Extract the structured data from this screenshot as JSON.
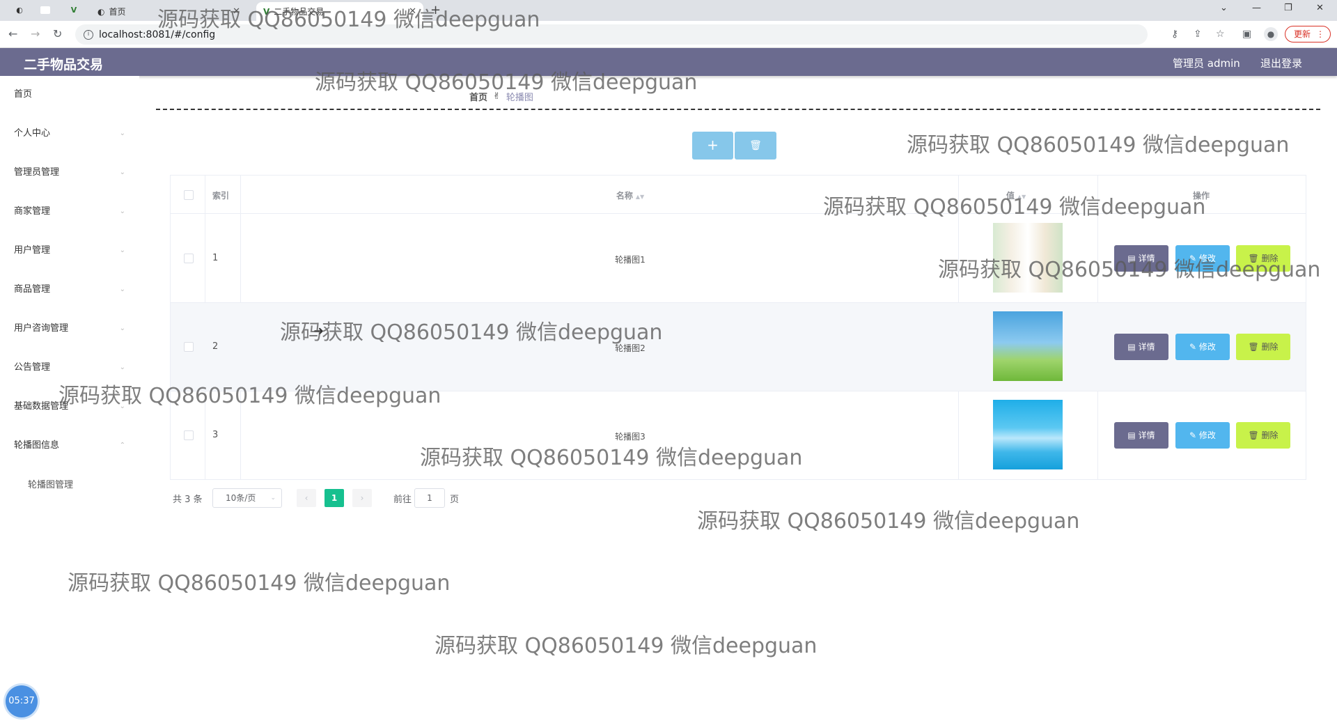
{
  "browser": {
    "tabs": [
      {
        "label": "首页"
      },
      {
        "label": "二手物品交易"
      }
    ],
    "url": "localhost:8081/#/config",
    "update_label": "更新"
  },
  "header": {
    "title": "二手物品交易",
    "user": "管理员 admin",
    "logout": "退出登录"
  },
  "sidebar": {
    "items": [
      {
        "label": "首页",
        "has_children": false
      },
      {
        "label": "个人中心",
        "has_children": true
      },
      {
        "label": "管理员管理",
        "has_children": true
      },
      {
        "label": "商家管理",
        "has_children": true
      },
      {
        "label": "用户管理",
        "has_children": true
      },
      {
        "label": "商品管理",
        "has_children": true
      },
      {
        "label": "用户咨询管理",
        "has_children": true
      },
      {
        "label": "公告管理",
        "has_children": true
      },
      {
        "label": "基础数据管理",
        "has_children": true
      },
      {
        "label": "轮播图信息",
        "has_children": true,
        "expanded": true
      }
    ],
    "sub_items": [
      {
        "label": "轮播图管理"
      }
    ]
  },
  "breadcrumb": {
    "home": "首页",
    "current": "轮播图"
  },
  "toolbar": {
    "add_label": "+",
    "delete_icon": "trash-icon"
  },
  "table": {
    "headers": {
      "index": "索引",
      "name": "名称",
      "value": "值",
      "actions": "操作"
    },
    "rows": [
      {
        "index": "1",
        "name": "轮播图1",
        "image": "light floral"
      },
      {
        "index": "2",
        "name": "轮播图2",
        "image": "green grass and sky"
      },
      {
        "index": "3",
        "name": "轮播图3",
        "image": "blue water splash"
      }
    ],
    "actions": {
      "detail": "详情",
      "edit": "修改",
      "delete": "删除"
    }
  },
  "pagination": {
    "total": "共 3 条",
    "page_size": "10条/页",
    "current_page": "1",
    "goto_label": "前往",
    "goto_value": "1",
    "page_unit": "页"
  },
  "watermark": "源码获取 QQ86050149 微信deepguan",
  "timer": "05:37",
  "colors": {
    "header_bg": "#6b6b8f",
    "detail_btn": "#6b6b8f",
    "edit_btn": "#52b6ee",
    "delete_btn": "#c8f24a",
    "page_active": "#16c08f"
  }
}
